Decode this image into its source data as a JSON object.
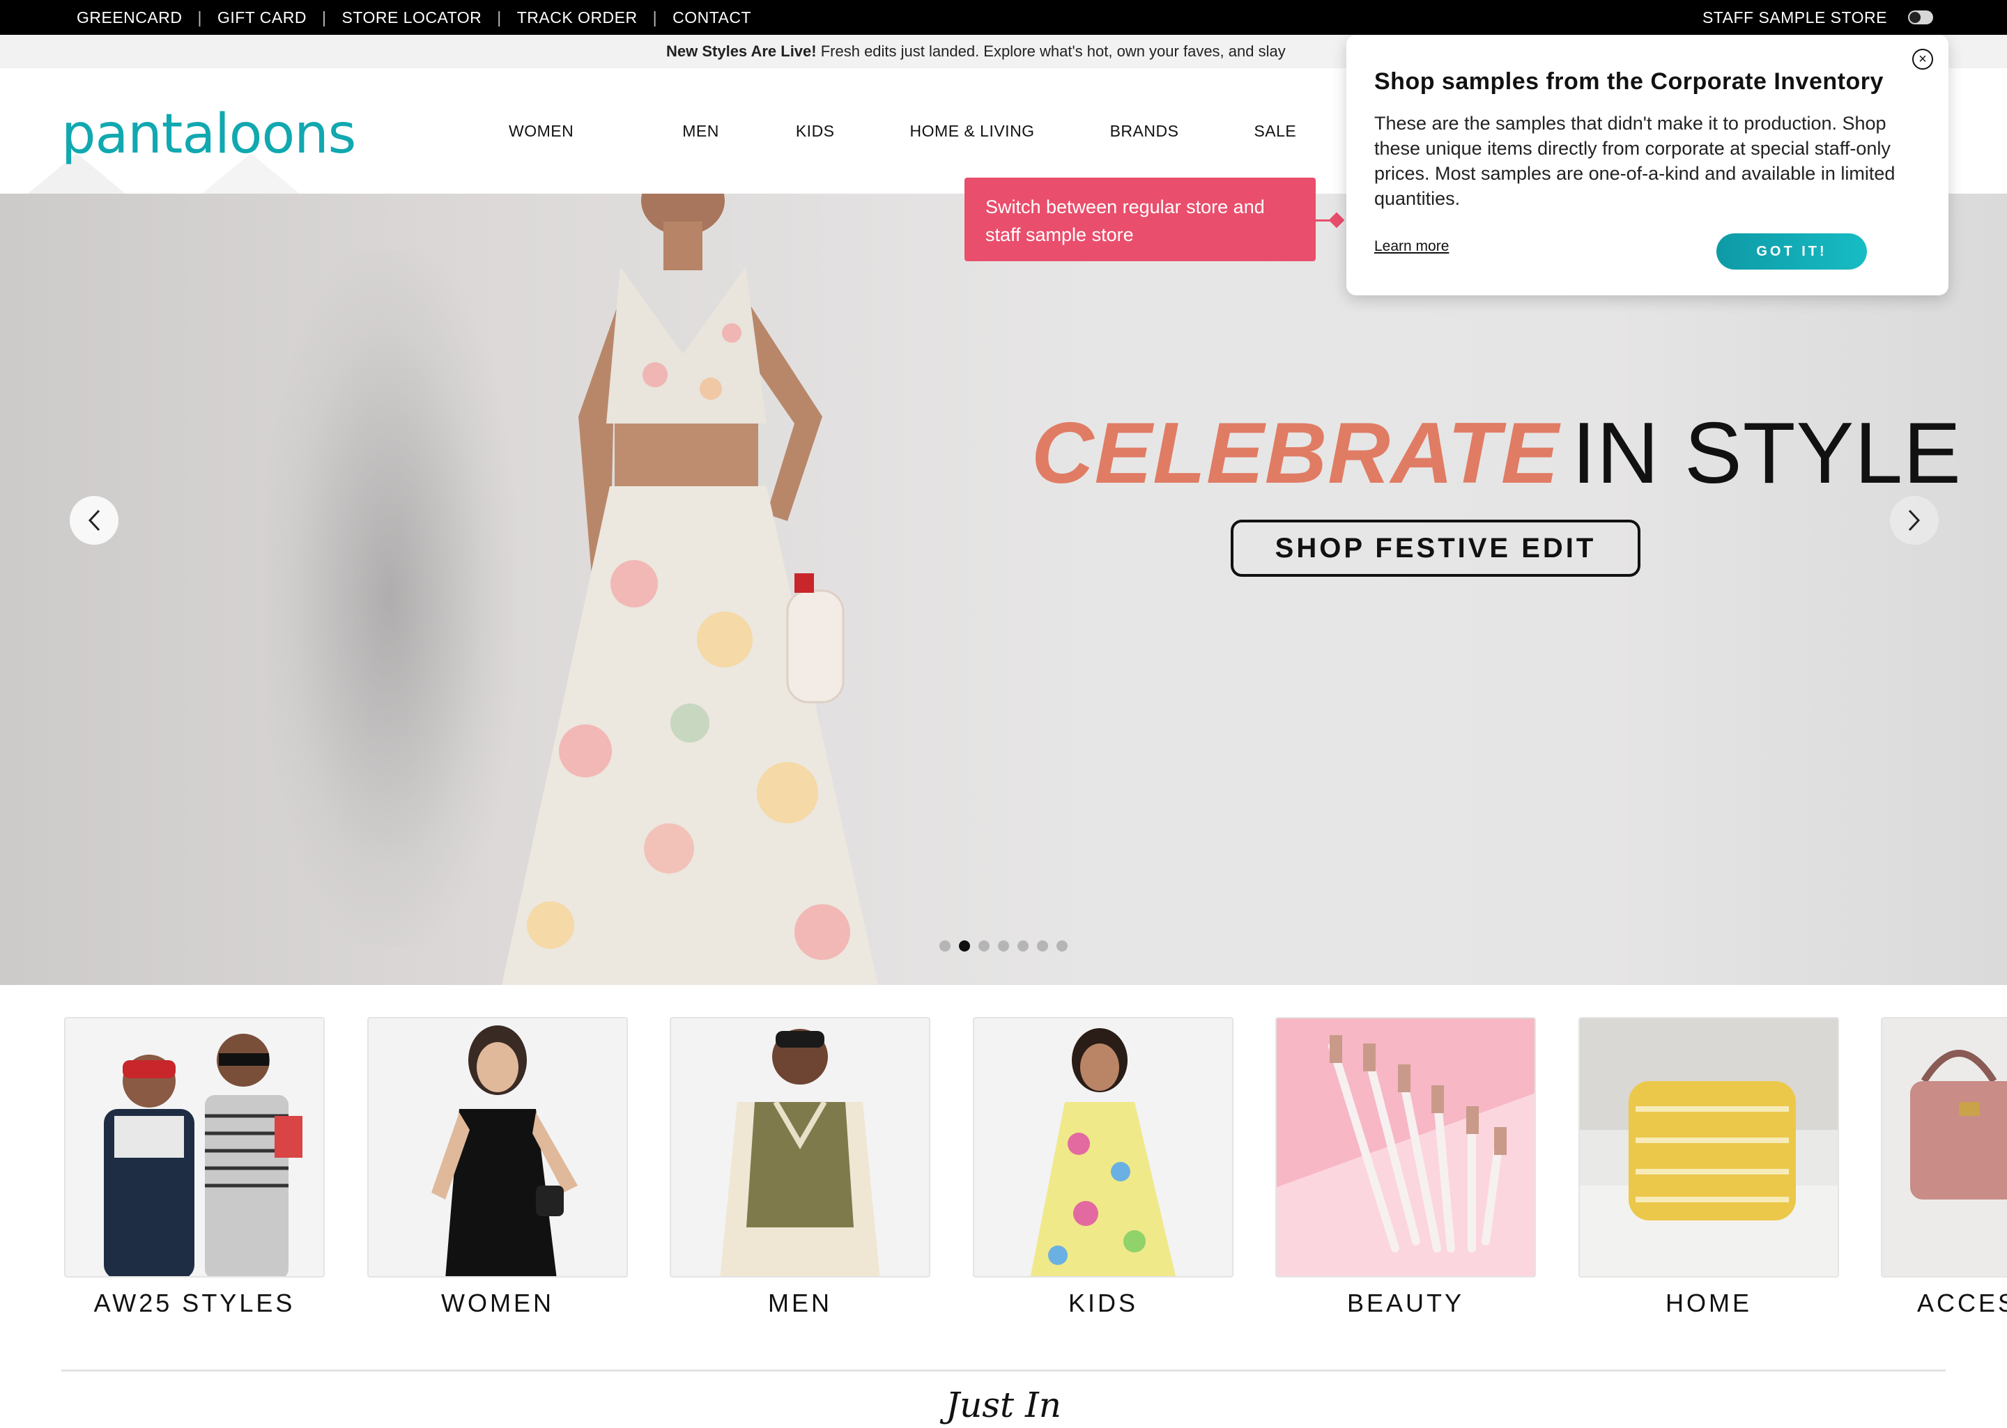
{
  "utility": {
    "links": [
      "GREENCARD",
      "GIFT CARD",
      "STORE LOCATOR",
      "TRACK ORDER",
      "CONTACT"
    ],
    "staff_label": "STAFF SAMPLE STORE"
  },
  "announcement": {
    "bold": "New Styles Are Live!",
    "text": " Fresh edits just landed. Explore what's hot, own your faves, and slay"
  },
  "header": {
    "logo": "pantaloons",
    "nav": [
      "WOMEN",
      "MEN",
      "KIDS",
      "HOME & LIVING",
      "BRANDS",
      "SALE"
    ]
  },
  "hero": {
    "headline_part1": "CELEBRATE",
    "headline_part2": "IN STYLE",
    "cta": "SHOP FESTIVE EDIT",
    "slide_count": 7,
    "active_slide": 2
  },
  "tooltip": {
    "text": "Switch between regular store and staff sample store"
  },
  "popover": {
    "title": "Shop samples from the Corporate Inventory",
    "body": "These are the samples that didn't make it to production. Shop these unique items directly from corporate at special staff-only prices. Most samples are one-of-a-kind and available in limited quantities.",
    "learn_more": "Learn more",
    "got_it": "GOT IT!"
  },
  "categories": [
    {
      "label": "AW25 STYLES"
    },
    {
      "label": "WOMEN"
    },
    {
      "label": "MEN"
    },
    {
      "label": "KIDS"
    },
    {
      "label": "BEAUTY"
    },
    {
      "label": "HOME"
    },
    {
      "label": "ACCESSORIES"
    }
  ],
  "section_title": "Just In",
  "colors": {
    "brand_teal": "#11a8b0",
    "tooltip_pink": "#e94e6c",
    "headline_coral": "#e07c64"
  }
}
